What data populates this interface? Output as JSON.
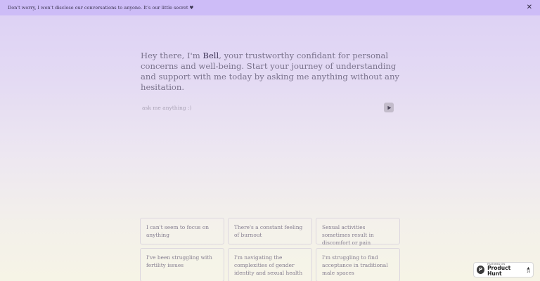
{
  "banner": {
    "text": "Don't worry, I won't disclose our conversations to anyone. It's our little secret ♥",
    "close_icon": "close-icon",
    "close_glyph": "✕"
  },
  "intro": {
    "before": "Hey there, I'm ",
    "name": "Bell",
    "after": ", your trustworthy confidant for personal concerns and well-being. Start your journey of understanding and support with me today by asking me anything without any hesitation."
  },
  "ask": {
    "placeholder": "ask me anything :)",
    "value": "",
    "send_icon": "play-icon"
  },
  "suggestions": [
    "I can't seem to focus on anything",
    "There's a constant feeling of burnout",
    "Sexual activities sometimes result in discomfort or pain",
    "I've been struggling with fertility issues",
    "I'm navigating the complexities of gender identity and sexual health",
    "I'm struggling to find acceptance in traditional male spaces"
  ],
  "product_hunt": {
    "small_label": "FEATURED ON",
    "label": "Product Hunt",
    "logo_letter": "P",
    "arrow": "▲",
    "count": "16"
  },
  "colors": {
    "banner_bg": "#cdbcf7",
    "name_color": "#3f3558",
    "text_color": "#7a738c"
  }
}
